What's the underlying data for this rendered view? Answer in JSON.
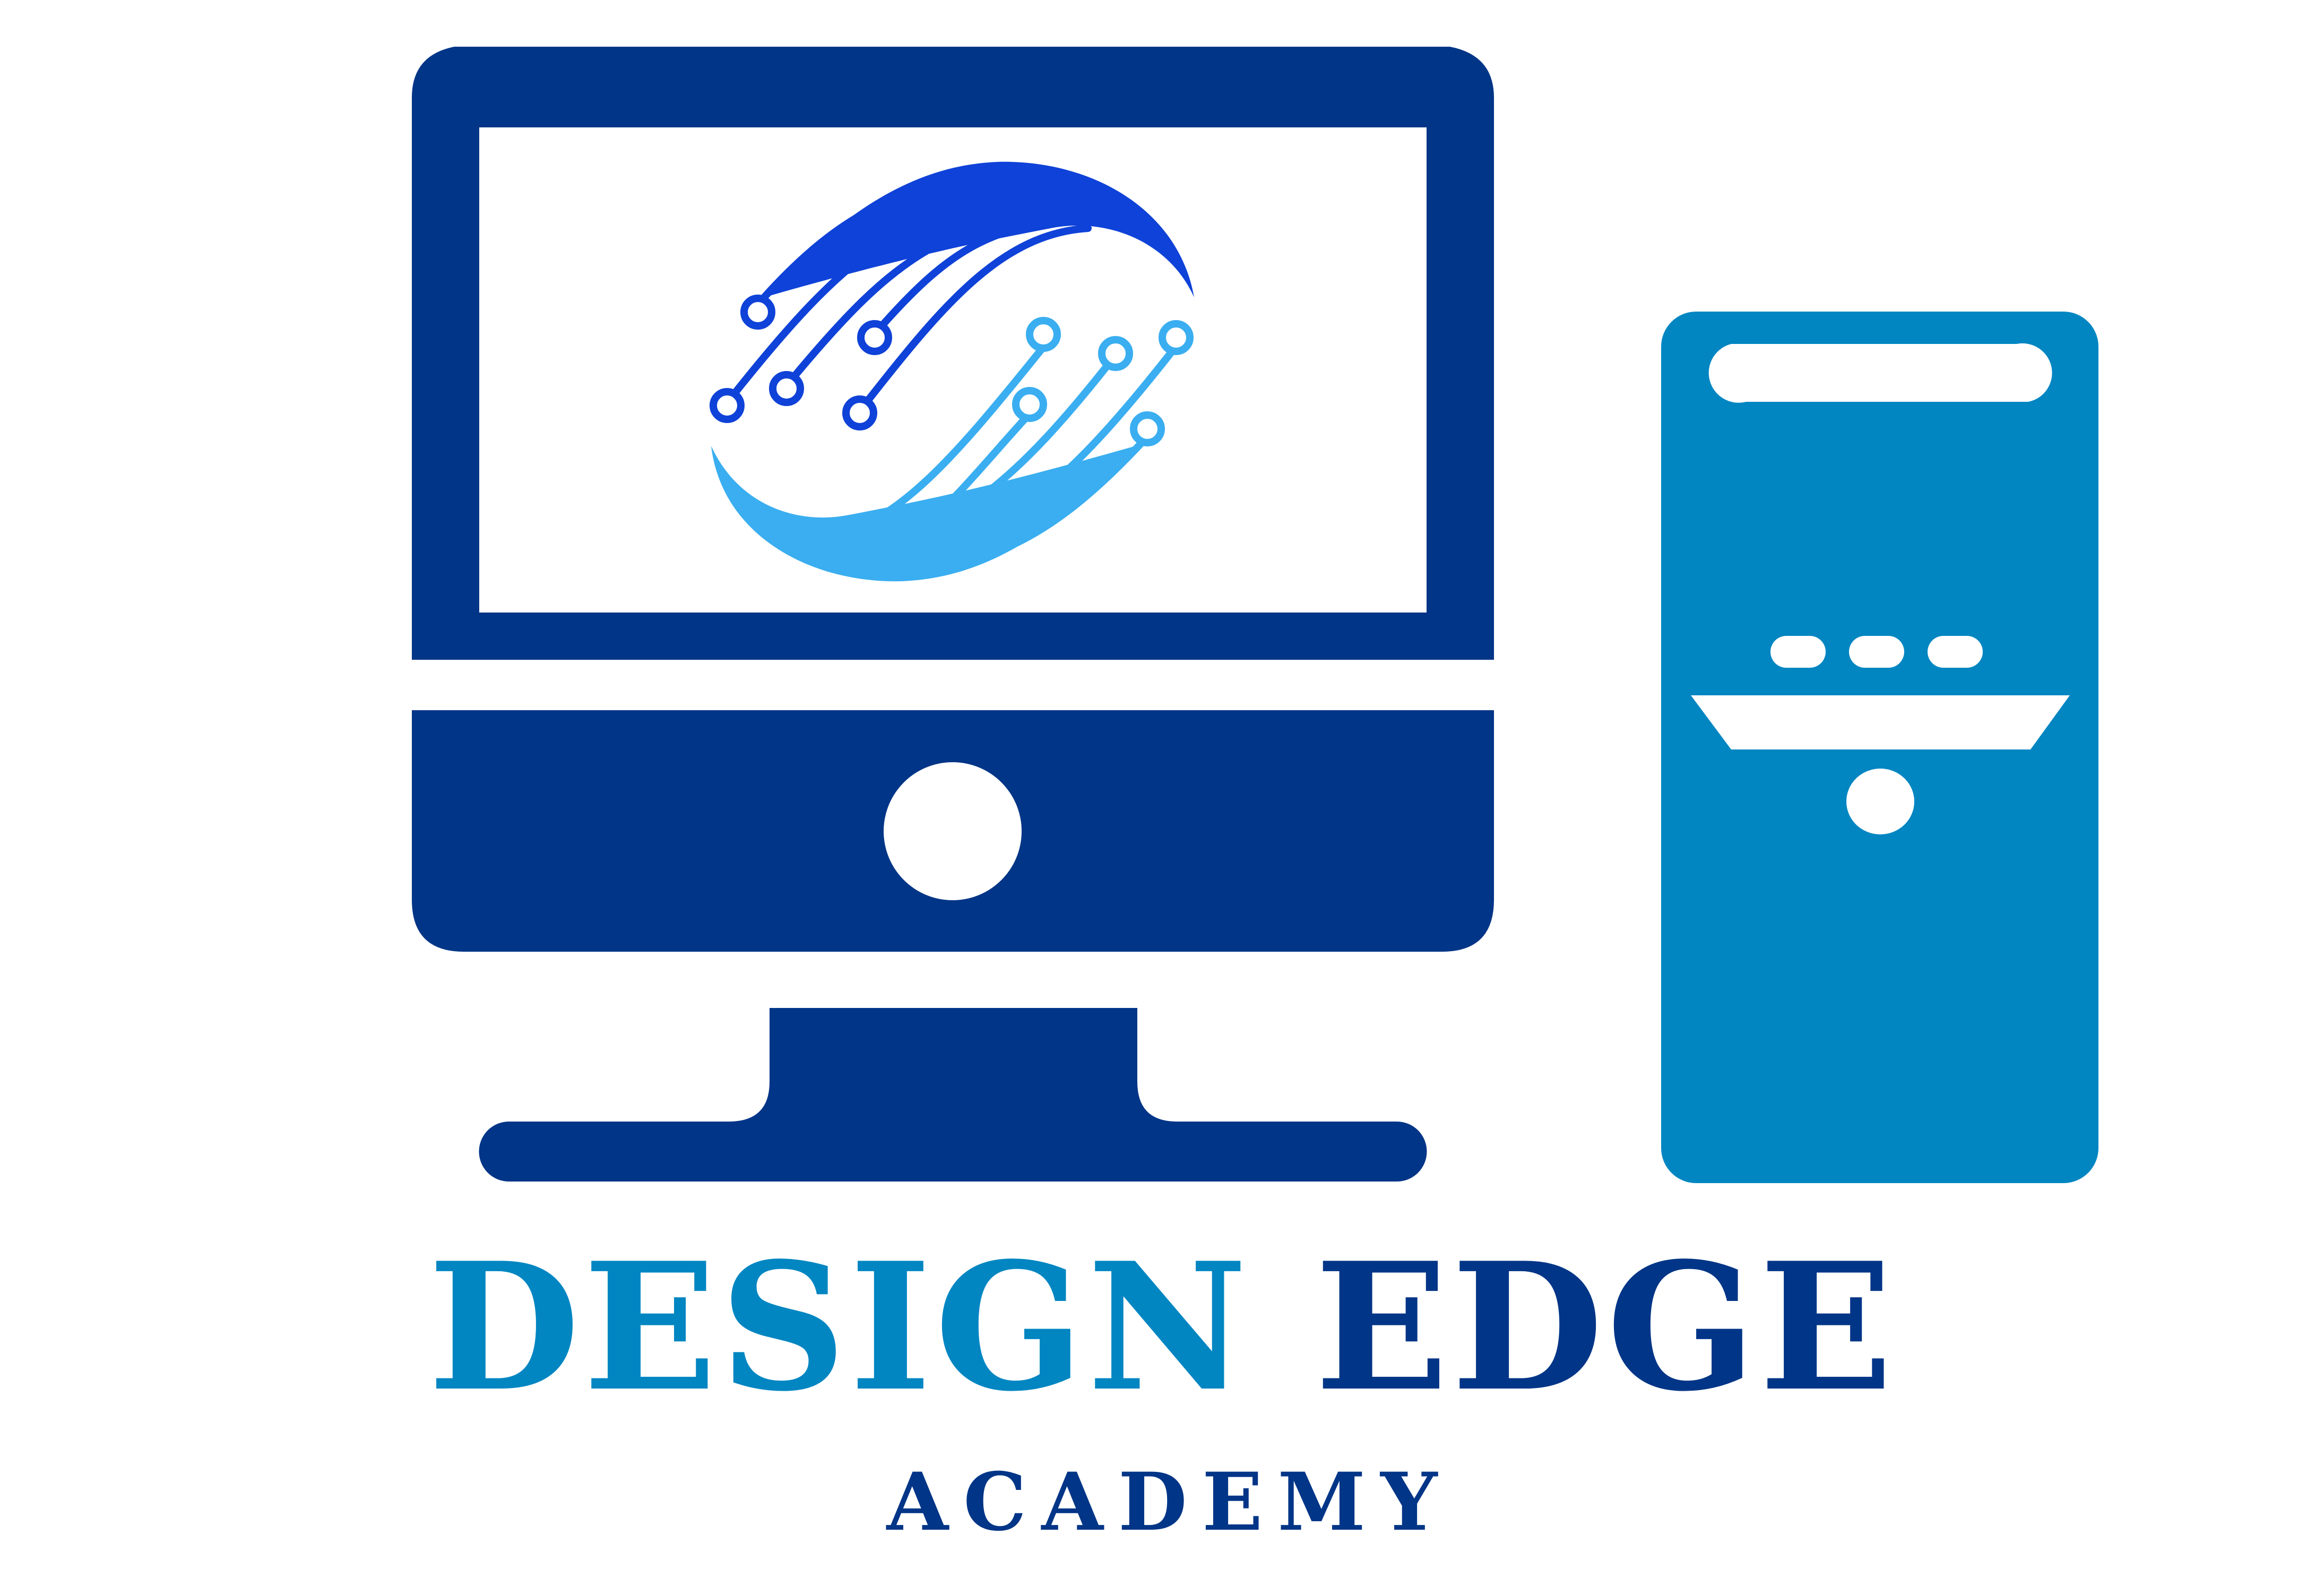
{
  "brand": {
    "word_primary": "DESIGN",
    "word_secondary": "EDGE",
    "tagline": "ACADEMY"
  },
  "colors": {
    "navy": "#003587",
    "teal": "#0286c2",
    "circuit_dark": "#0f42d8",
    "circuit_light": "#3aaef0",
    "background": "#ffffff"
  },
  "icons": {
    "monitor": "desktop-monitor-icon",
    "tower": "computer-tower-icon",
    "emblem": "circuit-swirl-icon"
  }
}
